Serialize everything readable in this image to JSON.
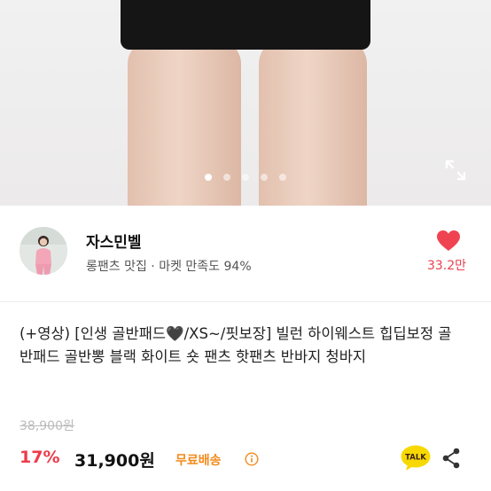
{
  "gallery": {
    "image_alt": "product photo",
    "dots": [
      true,
      false,
      false,
      false,
      false
    ],
    "expand_icon": "expand-arrows-icon"
  },
  "seller": {
    "name": "자스민벨",
    "subtitle": "롱팬츠 맛집 · 마켓 만족도 94%",
    "likes": "33.2만",
    "colors": {
      "heart": "#f04352"
    }
  },
  "product": {
    "title": "(+영상) [인생 골반패드🖤/XS~/핏보장] 빌런 하이웨스트 힙딥보정 골반패드 골반뽕 블랙 화이트 숏 팬츠 핫팬츠 반바지 청바지",
    "original_price": "38,900원",
    "discount": "17%",
    "price": "31,900원",
    "shipping": "무료배송",
    "talk_label": "TALK"
  },
  "colors": {
    "discount": "#ef3b4a",
    "shipping": "#f28a1c",
    "talk_badge": "#f7d900"
  }
}
